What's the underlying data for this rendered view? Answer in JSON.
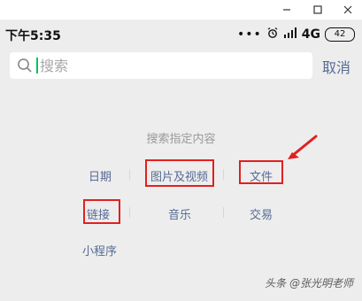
{
  "window": {
    "minimize_icon": "minimize-icon",
    "maximize_icon": "maximize-icon",
    "close_icon": "close-icon"
  },
  "status_bar": {
    "time": "下午5:35",
    "network": "4G",
    "battery": "42"
  },
  "search": {
    "placeholder": "搜索",
    "cancel_label": "取消"
  },
  "content": {
    "title": "搜索指定内容",
    "row1": [
      "日期",
      "图片及视频",
      "文件"
    ],
    "row2": [
      "链接",
      "音乐",
      "交易"
    ],
    "row3": [
      "小程序"
    ]
  },
  "watermark": "头条 @张光明老师",
  "colors": {
    "link": "#576b95",
    "highlight": "#e12020",
    "caret": "#07c160"
  }
}
